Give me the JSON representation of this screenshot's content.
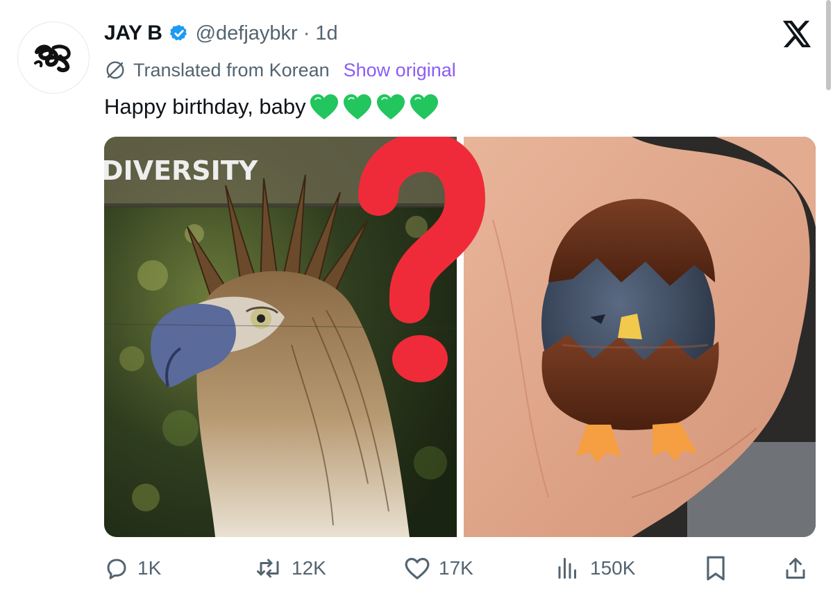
{
  "author": {
    "display_name": "JAY B",
    "verified": true,
    "handle": "@defjaybkr",
    "separator": "·",
    "time": "1d",
    "avatar_icon": "ribbon-logo-icon"
  },
  "translation": {
    "label": "Translated from Korean",
    "action": "Show original",
    "icon": "translate-globe-icon"
  },
  "tweet": {
    "text": "Happy birthday, baby",
    "emoji": [
      "💚",
      "💚",
      "💚",
      "💚"
    ],
    "heart_color": "#22c55e"
  },
  "media": {
    "left_image": {
      "sign_text": "DIVERSITY",
      "subject": "philippine-eagle"
    },
    "right_image": {
      "subject": "chick-in-egg-figurine"
    },
    "overlay_mark": "question-mark",
    "overlay_color": "#ef2b3a"
  },
  "actions": {
    "reply": {
      "count": "1K",
      "icon": "reply-icon"
    },
    "repost": {
      "count": "12K",
      "icon": "repost-icon"
    },
    "like": {
      "count": "17K",
      "icon": "heart-icon"
    },
    "views": {
      "count": "150K",
      "icon": "views-icon"
    },
    "bookmark": {
      "icon": "bookmark-icon"
    },
    "share": {
      "icon": "share-icon"
    }
  },
  "colors": {
    "text_primary": "#0f1419",
    "text_secondary": "#536471",
    "verified_blue": "#1d9bf0",
    "link_purple": "#8b5cf6"
  }
}
